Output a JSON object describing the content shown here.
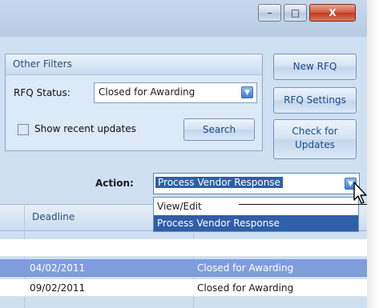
{
  "window_controls": {
    "minimize": "–",
    "maximize": "□",
    "close": "X"
  },
  "filters": {
    "group_title": "Other Filters",
    "rfq_status_label": "RFQ Status:",
    "rfq_status_value": "Closed for Awarding",
    "show_recent_label": "Show recent updates",
    "search_button": "Search"
  },
  "side_buttons": {
    "new_rfq": "New RFQ",
    "rfq_settings": "RFQ Settings",
    "check_updates_line1": "Check for",
    "check_updates_line2": "Updates"
  },
  "action": {
    "label": "Action:",
    "selected": "Process Vendor Response",
    "options": [
      "View/Edit",
      "Process Vendor Response"
    ]
  },
  "grid": {
    "columns": [
      "Deadline"
    ],
    "rows": [
      {
        "deadline": "04/02/2011",
        "status": "Closed for Awarding"
      },
      {
        "deadline": "09/02/2011",
        "status": "Closed for Awarding"
      }
    ]
  }
}
